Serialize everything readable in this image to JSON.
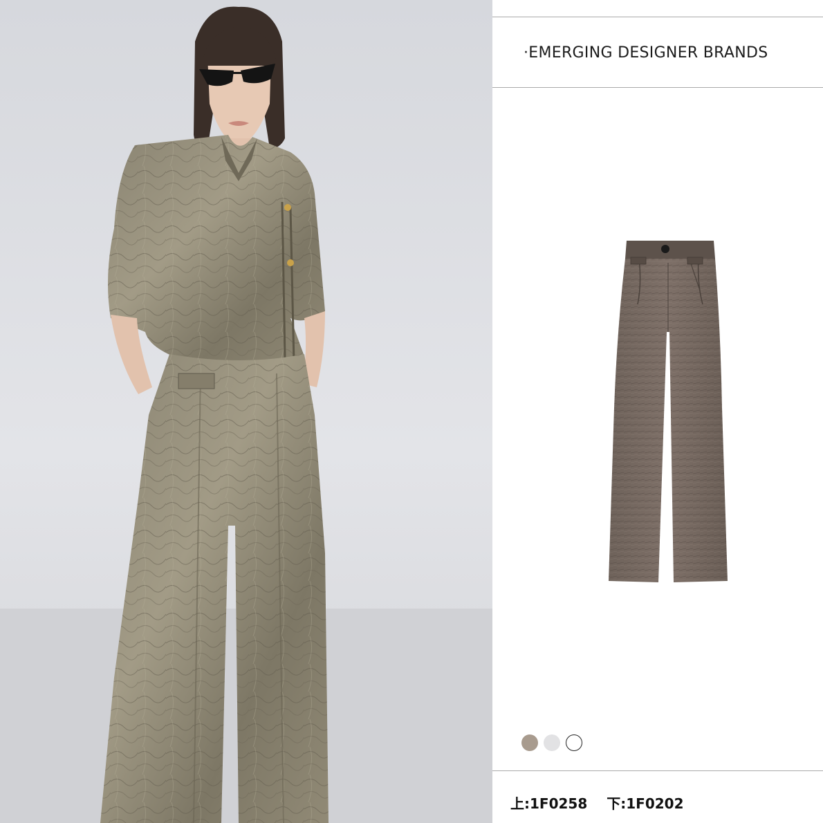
{
  "brand": {
    "heading": "·EMERGING DESIGNER BRANDS"
  },
  "swatches": [
    {
      "color": "#a89b8e"
    },
    {
      "color": "#e2e2e4"
    },
    {
      "color": "#ffffff"
    }
  ],
  "codes": {
    "top": "上:1F0258",
    "bottom": "下:1F0202"
  }
}
